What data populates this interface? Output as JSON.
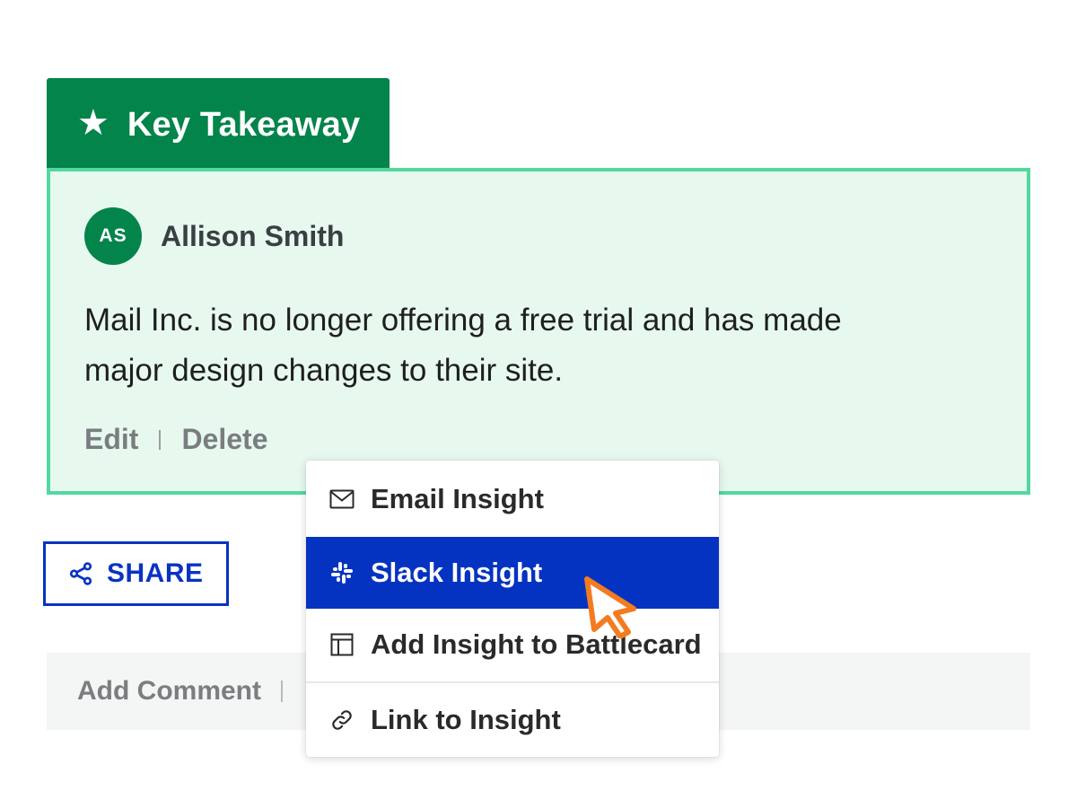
{
  "tab": {
    "icon": "star-icon",
    "label": "Key Takeaway"
  },
  "card": {
    "author": {
      "initials": "AS",
      "name": "Allison Smith"
    },
    "text_line1": "Mail Inc. is no longer offering a free trial and has made",
    "text_line2": "major design changes to their site.",
    "actions": {
      "edit": "Edit",
      "delete": "Delete"
    }
  },
  "share": {
    "icon": "share-icon",
    "label": "SHARE"
  },
  "comment_bar": {
    "add_comment": "Add Comment"
  },
  "menu": {
    "items": [
      {
        "icon": "mail-icon",
        "label": "Email Insight"
      },
      {
        "icon": "slack-icon",
        "label": "Slack Insight",
        "highlighted": true
      },
      {
        "icon": "battlecard-icon",
        "label": "Add Insight to Battlecard"
      },
      {
        "icon": "link-icon",
        "label": "Link to Insight"
      }
    ]
  },
  "colors": {
    "brand_green": "#03844b",
    "card_border": "#52d89f",
    "card_background": "#e7f9ef",
    "share_blue": "#0a33c2",
    "menu_highlight": "#0533c1",
    "cursor_orange": "#f47b20"
  }
}
